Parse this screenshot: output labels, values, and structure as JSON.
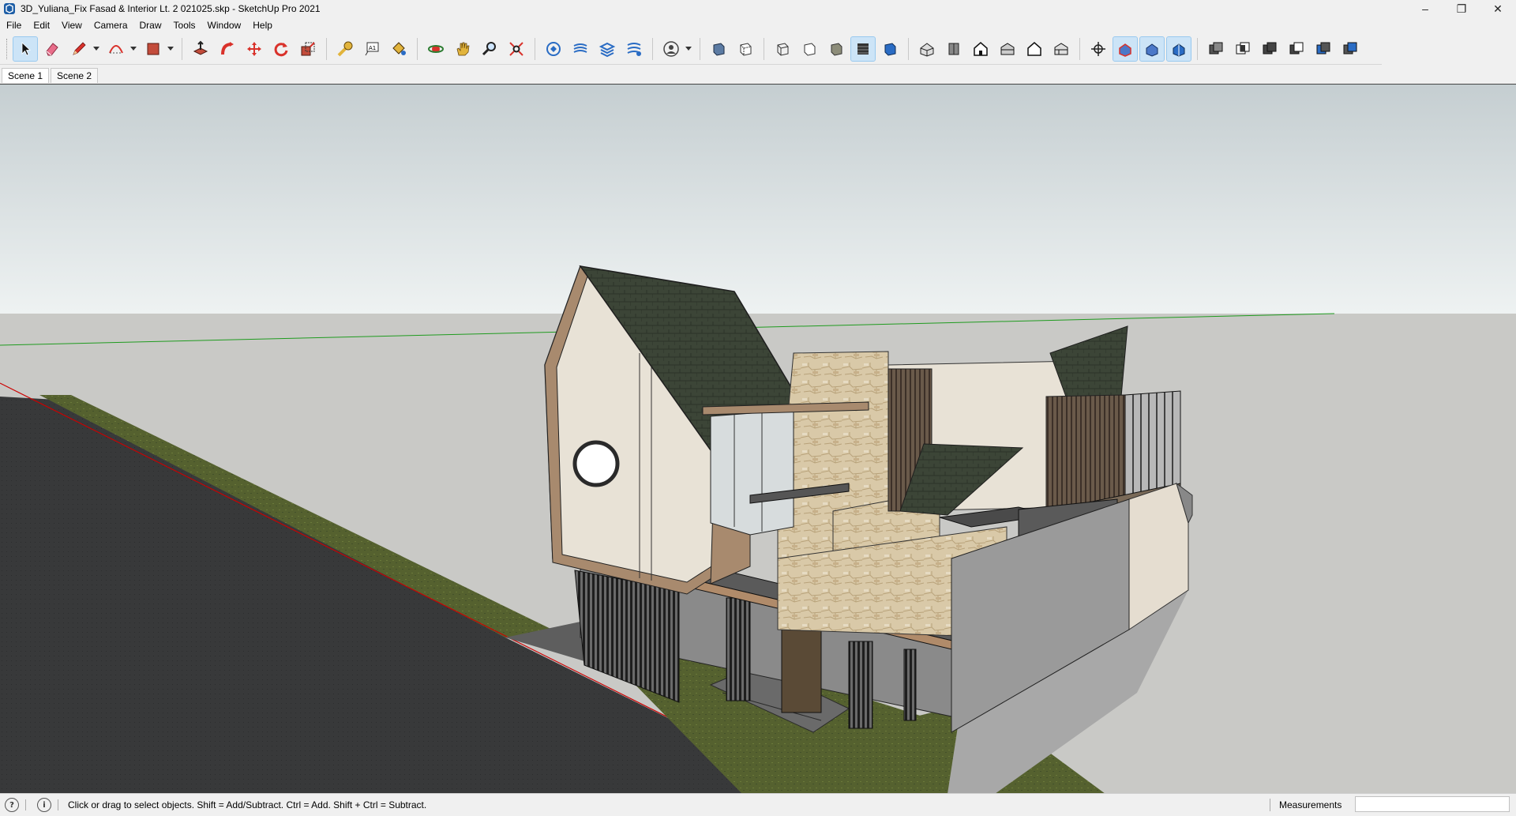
{
  "window": {
    "title": "3D_Yuliana_Fix Fasad & Interior Lt. 2 021025.skp - SketchUp Pro 2021",
    "controls": {
      "minimize": "–",
      "maximize": "❐",
      "close": "✕"
    }
  },
  "menu": [
    "File",
    "Edit",
    "View",
    "Camera",
    "Draw",
    "Tools",
    "Window",
    "Help"
  ],
  "toolbar": {
    "groups": [
      [
        "select-icon",
        "eraser-icon",
        "pencil-icon",
        "arc-icon",
        "rectangle-icon"
      ],
      [
        "push-pull-icon",
        "follow-me-icon",
        "move-icon",
        "rotate-icon",
        "scale-icon"
      ],
      [
        "tape-measure-icon",
        "text-icon",
        "paint-bucket-icon"
      ],
      [
        "orbit-icon",
        "pan-icon",
        "zoom-icon",
        "zoom-extents-icon"
      ],
      [
        "warehouse-icon",
        "extension-warehouse-icon",
        "layout-icon",
        "extension-manager-icon"
      ],
      [
        "profile-icon"
      ],
      [
        "xray-icon",
        "back-edges-icon",
        "wireframe-icon",
        "hidden-line-icon",
        "shaded-icon",
        "shaded-textures-icon",
        "monochrome-icon"
      ],
      [
        "iso-view-icon",
        "top-view-icon",
        "front-view-icon",
        "right-view-icon",
        "back-view-icon",
        "left-view-icon"
      ],
      [
        "section-plane-icon",
        "display-section-planes-icon",
        "display-section-cuts-icon",
        "display-section-fill-icon"
      ],
      [
        "outer-shell-icon",
        "intersect-icon",
        "union-icon",
        "subtract-icon",
        "trim-icon",
        "split-icon"
      ]
    ],
    "active": [
      "select-icon",
      "shaded-textures-icon",
      "display-section-planes-icon",
      "display-section-cuts-icon",
      "display-section-fill-icon"
    ],
    "colors": {
      "accent": "#cce4f7",
      "red": "#d9322b",
      "blue": "#2a6cc4",
      "green": "#3a9b3a"
    }
  },
  "scenes": [
    {
      "label": "Scene 1",
      "active": true
    },
    {
      "label": "Scene 2",
      "active": false
    }
  ],
  "viewport": {
    "colors": {
      "sky_top": "#c5ced1",
      "sky_bottom": "#eef2f2",
      "ground": "#c9c9c6",
      "road": "#38393a",
      "grass": "#4f5b2e",
      "axis_red": "#cc0000",
      "axis_green": "#1f9b1f"
    }
  },
  "status": {
    "help_text": "Click or drag to select objects. Shift = Add/Subtract. Ctrl = Add. Shift + Ctrl = Subtract.",
    "measurements_label": "Measurements",
    "measurements_value": ""
  }
}
